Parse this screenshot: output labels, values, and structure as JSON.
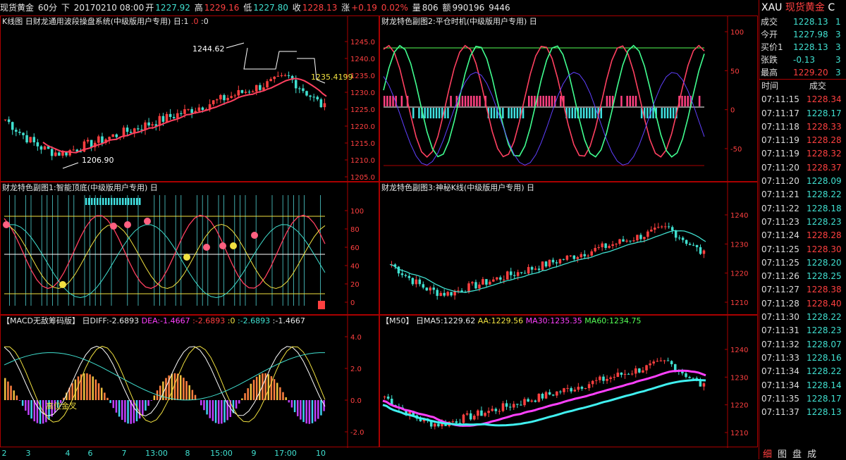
{
  "topbar": {
    "symbol": "现货黄金",
    "period": "60分",
    "direction": "下",
    "datetime": "20170210 08:00",
    "open_label": "开",
    "open": "1227.92",
    "high_label": "高",
    "high": "1229.16",
    "low_label": "低",
    "low": "1227.80",
    "close_label": "收",
    "close": "1228.13",
    "change_label": "涨",
    "change": "+0.19",
    "change_pct": "0.02%",
    "volume_label": "量",
    "volume": "806",
    "amount_label": "额",
    "amount": "990196",
    "extra": "9446"
  },
  "panels": {
    "main": {
      "title_a": "K线图",
      "title_b": "日财龙通用波段操盘系统(中级版用户专用)",
      "title_c": "日:1",
      "title_d": ".0",
      "title_e": ":0",
      "annot_high": "1244.62",
      "annot_low": "1206.90",
      "annot_right": "1235.4199",
      "yticks": [
        "1245.0",
        "1240.0",
        "1235.0",
        "1230.0",
        "1225.0",
        "1220.0",
        "1215.0",
        "1210.0",
        "1205.0"
      ]
    },
    "sub2": {
      "title": "财龙特色副图2:平仓时机(中级版用户专用) 日",
      "yticks": [
        "100",
        "50",
        "0",
        "-50"
      ]
    },
    "sub1": {
      "title": "财龙特色副图1:智能顶底(中级版用户专用) 日",
      "yticks": [
        "100",
        "80",
        "60",
        "40",
        "20",
        "0"
      ]
    },
    "sub3": {
      "title": "财龙特色副图3:神秘K线(中级版用户专用) 日",
      "yticks": [
        "1240",
        "1230",
        "1220",
        "1210"
      ]
    },
    "macd": {
      "title": "【MACD无敌筹码版】",
      "diff_label": "日DIFF:-2.6893",
      "dea_label": "DEA:-1.4667",
      "v3": ":-2.6893",
      "v4": ":0",
      "v5": ":-2.6893",
      "v6": ":-1.4667",
      "annot": "高位金叉",
      "yticks": [
        "4.0",
        "2.0",
        "0.0",
        "-2.0"
      ]
    },
    "ma": {
      "title": "【M50】",
      "ma5": "日MA5:1229.62",
      "aa": "AA:1229.56",
      "ma30": "MA30:1235.35",
      "ma60": "MA60:1234.75",
      "yticks": [
        "1240",
        "1230",
        "1220",
        "1210"
      ]
    }
  },
  "xaxis": [
    "2",
    "3",
    "4",
    "6",
    "7",
    "13:00",
    "8",
    "15:00",
    "9",
    "17:00",
    "10"
  ],
  "quote": {
    "code": "XAU",
    "name": "现货黄金",
    "extra": "C",
    "rows": [
      {
        "label": "成交",
        "value": "1228.13",
        "color": "#40e0d0"
      },
      {
        "label": "今开",
        "value": "1227.98",
        "color": "#40e0d0"
      },
      {
        "label": "买价1",
        "value": "1228.13",
        "color": "#40e0d0"
      },
      {
        "label": "张跌",
        "value": "-0.13",
        "color": "#40e0d0"
      },
      {
        "label": "最高",
        "value": "1229.20",
        "color": "#ff4040"
      }
    ],
    "right_col": [
      "1",
      "3",
      "3",
      "3",
      "3"
    ],
    "tick_header_time": "时间",
    "tick_header_price": "成交",
    "ticks": [
      {
        "time": "07:11:15",
        "price": "1228.34",
        "color": "#ff4040"
      },
      {
        "time": "07:11:17",
        "price": "1228.17",
        "color": "#40e0d0"
      },
      {
        "time": "07:11:18",
        "price": "1228.33",
        "color": "#ff4040"
      },
      {
        "time": "07:11:19",
        "price": "1228.28",
        "color": "#ff4040"
      },
      {
        "time": "07:11:19",
        "price": "1228.32",
        "color": "#ff4040"
      },
      {
        "time": "07:11:20",
        "price": "1228.37",
        "color": "#ff4040"
      },
      {
        "time": "07:11:20",
        "price": "1228.09",
        "color": "#40e0d0"
      },
      {
        "time": "07:11:21",
        "price": "1228.22",
        "color": "#40e0d0"
      },
      {
        "time": "07:11:22",
        "price": "1228.18",
        "color": "#40e0d0"
      },
      {
        "time": "07:11:23",
        "price": "1228.23",
        "color": "#40e0d0"
      },
      {
        "time": "07:11:24",
        "price": "1228.28",
        "color": "#ff4040"
      },
      {
        "time": "07:11:25",
        "price": "1228.30",
        "color": "#ff4040"
      },
      {
        "time": "07:11:25",
        "price": "1228.20",
        "color": "#40e0d0"
      },
      {
        "time": "07:11:26",
        "price": "1228.25",
        "color": "#40e0d0"
      },
      {
        "time": "07:11:27",
        "price": "1228.38",
        "color": "#ff4040"
      },
      {
        "time": "07:11:28",
        "price": "1228.40",
        "color": "#ff4040"
      },
      {
        "time": "07:11:30",
        "price": "1228.22",
        "color": "#40e0d0"
      },
      {
        "time": "07:11:31",
        "price": "1228.23",
        "color": "#40e0d0"
      },
      {
        "time": "07:11:32",
        "price": "1228.07",
        "color": "#40e0d0"
      },
      {
        "time": "07:11:33",
        "price": "1228.16",
        "color": "#40e0d0"
      },
      {
        "time": "07:11:34",
        "price": "1228.22",
        "color": "#40e0d0"
      },
      {
        "time": "07:11:34",
        "price": "1228.14",
        "color": "#40e0d0"
      },
      {
        "time": "07:11:35",
        "price": "1228.17",
        "color": "#40e0d0"
      },
      {
        "time": "07:11:37",
        "price": "1228.13",
        "color": "#40e0d0"
      }
    ],
    "tabs": [
      "细",
      "图",
      "盘",
      "成"
    ]
  },
  "colors": {
    "up": "#ff4040",
    "down": "#40e0d0",
    "grid": "#a00000",
    "yellow": "#f0e040",
    "magenta": "#ff40ff"
  }
}
